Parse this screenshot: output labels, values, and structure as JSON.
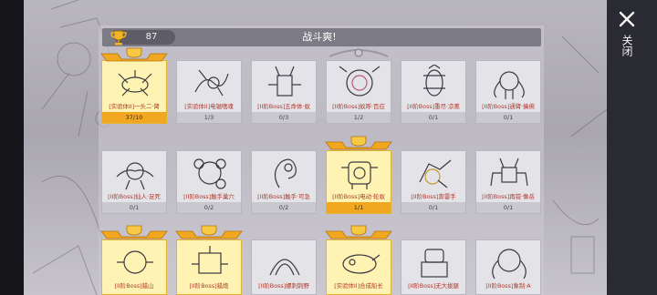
{
  "header": {
    "trophy_count": "87",
    "title": "战斗爽!"
  },
  "close_label": "关闭",
  "colors": {
    "gold": "#f2a721",
    "name_red": "#b0382c"
  },
  "cards": [
    {
      "name": "[实验体II]一头二·臂",
      "progress": "37/10",
      "achieved": true
    },
    {
      "name": "[实验体II]电锯嗜魂",
      "progress": "1/3",
      "achieved": false
    },
    {
      "name": "[II阶Boss]五命体·蚁",
      "progress": "0/3",
      "achieved": false
    },
    {
      "name": "[II阶Boss]蚁呼·百应",
      "progress": "1/2",
      "achieved": false
    },
    {
      "name": "[II阶Boss]重尽·凉熏",
      "progress": "0/1",
      "achieved": false
    },
    {
      "name": "[II阶Boss]通臂·擒佛",
      "progress": "0/1",
      "achieved": false
    },
    {
      "name": "[II阶Boss]仙人·足死",
      "progress": "0/1",
      "achieved": false
    },
    {
      "name": "[II阶Boss]触手巢穴",
      "progress": "0/2",
      "achieved": false
    },
    {
      "name": "[II阶Boss]触手·可急",
      "progress": "0/2",
      "achieved": false
    },
    {
      "name": "[II阶Boss]电动·轮蚁",
      "progress": "1/1",
      "achieved": true
    },
    {
      "name": "[II阶Boss]奔雷手",
      "progress": "0/1",
      "achieved": false
    },
    {
      "name": "[II阶Boss]再钳·像岳",
      "progress": "0/1",
      "achieved": false
    },
    {
      "name": "[II阶Boss]蜡山",
      "progress": "",
      "achieved": true
    },
    {
      "name": "[II阶Boss]蜡炮",
      "progress": "",
      "achieved": true
    },
    {
      "name": "[II阶Boss]螺刺刺野",
      "progress": "",
      "achieved": false
    },
    {
      "name": "[实验体II]合成船长",
      "progress": "",
      "achieved": true
    },
    {
      "name": "[II阶Boss]无大拔腿",
      "progress": "",
      "achieved": false
    },
    {
      "name": "[II阶Boss]象制·A",
      "progress": "",
      "achieved": false
    }
  ]
}
